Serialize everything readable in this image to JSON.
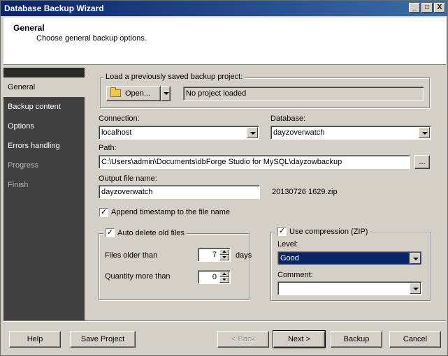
{
  "window": {
    "title": "Database Backup Wizard",
    "controls": {
      "minimize": "_",
      "maximize": "□",
      "close": "X"
    }
  },
  "header": {
    "title": "General",
    "subtitle": "Choose general backup options."
  },
  "sidebar": {
    "items": [
      {
        "label": "General",
        "state": "active"
      },
      {
        "label": "Backup content",
        "state": "normal"
      },
      {
        "label": "Options",
        "state": "normal"
      },
      {
        "label": "Errors handling",
        "state": "normal"
      },
      {
        "label": "Progress",
        "state": "disabled"
      },
      {
        "label": "Finish",
        "state": "disabled"
      }
    ]
  },
  "project": {
    "group_label": "Load a previously saved backup project:",
    "open_label": "Open...",
    "status": "No project loaded"
  },
  "connection": {
    "label": "Connection:",
    "value": "localhost"
  },
  "database": {
    "label": "Database:",
    "value": "dayzoverwatch"
  },
  "path": {
    "label": "Path:",
    "value": "C:\\Users\\admin\\Documents\\dbForge Studio for MySQL\\dayzowbackup",
    "browse_label": "..."
  },
  "output": {
    "label": "Output file name:",
    "value": "dayzoverwatch",
    "suffix": "20130726 1629.zip"
  },
  "append_timestamp": {
    "label": "Append timestamp to the file name",
    "checked": true
  },
  "auto_delete": {
    "label": "Auto delete old files",
    "checked": true,
    "files_older_label": "Files older than",
    "files_older_value": "7",
    "days_label": "days",
    "quantity_label": "Quantity more than",
    "quantity_value": "0"
  },
  "compression": {
    "label": "Use compression (ZIP)",
    "checked": true,
    "level_label": "Level:",
    "level_value": "Good",
    "comment_label": "Comment:",
    "comment_value": ""
  },
  "footer": {
    "help": "Help",
    "save_project": "Save Project",
    "back": "< Back",
    "next": "Next >",
    "backup": "Backup",
    "cancel": "Cancel"
  },
  "colors": {
    "titlebar_start": "#0a246a",
    "titlebar_end": "#3a6ea5",
    "sidebar_bg": "#404040",
    "selection": "#0a246a"
  }
}
